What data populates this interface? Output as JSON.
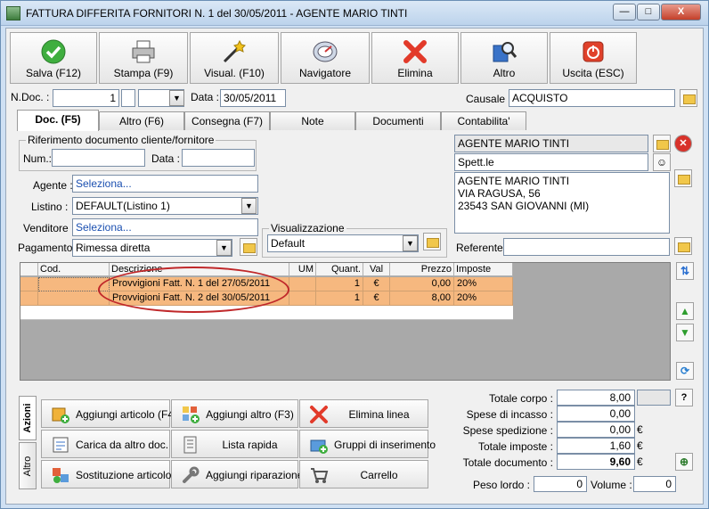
{
  "window": {
    "title": "FATTURA DIFFERITA FORNITORI N. 1  del 30/05/2011  - AGENTE MARIO TINTI",
    "minimize": "—",
    "maximize": "□",
    "close": "X"
  },
  "toolbar": [
    {
      "label": "Salva (F12)",
      "icon": "check-icon"
    },
    {
      "label": "Stampa (F9)",
      "icon": "printer-icon"
    },
    {
      "label": "Visual. (F10)",
      "icon": "magic-wand-icon"
    },
    {
      "label": "Navigatore",
      "icon": "navigator-icon"
    },
    {
      "label": "Elimina",
      "icon": "delete-x-icon"
    },
    {
      "label": "Altro",
      "icon": "search-book-icon"
    },
    {
      "label": "Uscita (ESC)",
      "icon": "power-icon"
    }
  ],
  "doc": {
    "ndoc_label": "N.Doc. :",
    "ndoc_value": "1",
    "data_label": "Data :",
    "data_value": "30/05/2011",
    "causale_label": "Causale :",
    "causale_value": "ACQUISTO"
  },
  "tabs": [
    "Doc. (F5)",
    "Altro (F6)",
    "Consegna (F7)",
    "Note",
    "Documenti",
    "Contabilita'"
  ],
  "rif": {
    "group_label": "Riferimento documento cliente/fornitore",
    "num_label": "Num.:",
    "num_value": "",
    "data_label": "Data :",
    "data_value": ""
  },
  "form": {
    "agente_label": "Agente :",
    "agente_value": "Seleziona...",
    "listino_label": "Listino :",
    "listino_value": "DEFAULT(Listino 1)",
    "venditore_label": "Venditore :",
    "venditore_value": "Seleziona...",
    "pagamento_label": "Pagamento :",
    "pagamento_value": "Rimessa diretta",
    "visual_label": "Visualizzazione",
    "visual_value": "Default"
  },
  "recipient": {
    "name": "AGENTE MARIO TINTI",
    "spett": "Spett.le",
    "address_lines": [
      "AGENTE MARIO TINTI",
      "VIA RAGUSA, 56",
      "23543 SAN GIOVANNI (MI)"
    ],
    "referente_label": "Referente",
    "referente_value": ""
  },
  "grid": {
    "headers": [
      "Cod.",
      "Descrizione",
      "UM",
      "Quant.",
      "Val",
      "Prezzo",
      "Imposte"
    ],
    "rows": [
      {
        "cod": "",
        "descrizione": "Provvigioni Fatt. N. 1 del 27/05/2011",
        "um": "",
        "quant": "1",
        "val": "€",
        "prezzo": "0,00",
        "imposte": "20%"
      },
      {
        "cod": "",
        "descrizione": "Provvigioni Fatt. N. 2 del 30/05/2011",
        "um": "",
        "quant": "1",
        "val": "€",
        "prezzo": "8,00",
        "imposte": "20%"
      }
    ]
  },
  "side_tabs": [
    "Azioni",
    "Altro"
  ],
  "actions": [
    {
      "label": "Aggiungi articolo (F4)",
      "icon": "add-article-icon"
    },
    {
      "label": "Aggiungi altro (F3)",
      "icon": "add-other-icon"
    },
    {
      "label": "Elimina linea",
      "icon": "delete-line-icon"
    },
    {
      "label": "Carica da altro doc.",
      "icon": "load-document-icon"
    },
    {
      "label": "Lista rapida",
      "icon": "quick-list-icon"
    },
    {
      "label": "Gruppi di inserimento",
      "icon": "insert-groups-icon"
    },
    {
      "label": "Sostituzione articolo",
      "icon": "replace-article-icon"
    },
    {
      "label": "Aggiungi riparazione",
      "icon": "wrench-icon"
    },
    {
      "label": "Carrello",
      "icon": "cart-icon"
    }
  ],
  "totals": {
    "corpo_label": "Totale corpo :",
    "corpo_value": "8,00",
    "incasso_label": "Spese di incasso :",
    "incasso_value": "0,00",
    "spedizione_label": "Spese spedizione :",
    "spedizione_value": "0,00",
    "imposte_label": "Totale imposte :",
    "imposte_value": "1,60",
    "documento_label": "Totale documento :",
    "documento_value": "9,60",
    "currency": "€",
    "help": "?",
    "peso_label": "Peso lordo :",
    "peso_value": "0",
    "volume_label": "Volume :",
    "volume_value": "0"
  }
}
